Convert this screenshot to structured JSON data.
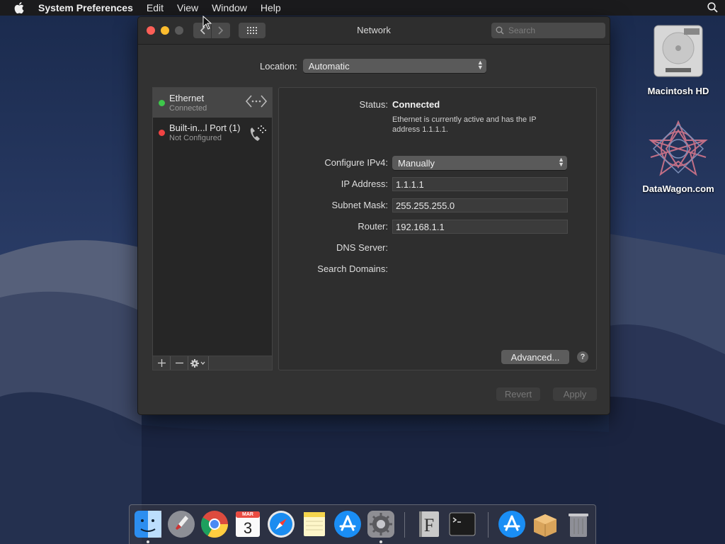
{
  "menubar": {
    "app_name": "System Preferences",
    "items": [
      "Edit",
      "View",
      "Window",
      "Help"
    ]
  },
  "window": {
    "title": "Network",
    "search_placeholder": "Search"
  },
  "location": {
    "label": "Location:",
    "value": "Automatic"
  },
  "services": [
    {
      "name": "Ethernet",
      "status": "Connected",
      "dot": "green",
      "icon": "ethernet-icon"
    },
    {
      "name": "Built-in...l Port (1)",
      "status": "Not Configured",
      "dot": "red",
      "icon": "phone-icon"
    }
  ],
  "detail": {
    "status_label": "Status:",
    "status_value": "Connected",
    "status_description": "Ethernet is currently active and has the IP address 1.1.1.1.",
    "configure_label": "Configure IPv4:",
    "configure_value": "Manually",
    "ip_label": "IP Address:",
    "ip_value": "1.1.1.1",
    "subnet_label": "Subnet Mask:",
    "subnet_value": "255.255.255.0",
    "router_label": "Router:",
    "router_value": "192.168.1.1",
    "dns_label": "DNS Server:",
    "search_domains_label": "Search Domains:",
    "advanced_label": "Advanced...",
    "help_label": "?"
  },
  "buttons": {
    "revert": "Revert",
    "apply": "Apply"
  },
  "desktop": {
    "icons": [
      {
        "label": "Macintosh HD"
      },
      {
        "label": "DataWagon.com"
      }
    ]
  },
  "dock": {
    "calendar_month": "MAR",
    "calendar_day": "3",
    "apps": [
      "finder",
      "launchpad",
      "chrome",
      "calendar",
      "safari",
      "notes",
      "app-store",
      "system-preferences",
      "font-book",
      "terminal",
      "app-store-downloads",
      "archive-utility",
      "trash"
    ]
  },
  "colors": {
    "status_green": "#3ec74b",
    "status_red": "#f04343",
    "close": "#fd5f57",
    "minimize": "#fdbc2e"
  }
}
